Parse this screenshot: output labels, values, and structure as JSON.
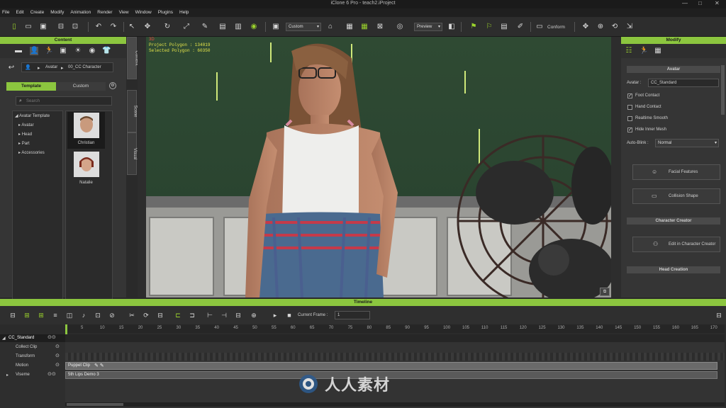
{
  "window": {
    "title": "iClone 6 Pro - teach2.iProject",
    "minimize": "—",
    "maximize": "□",
    "close": "✕"
  },
  "menu": [
    "File",
    "Edit",
    "Create",
    "Modify",
    "Animation",
    "Render",
    "View",
    "Window",
    "Plugins",
    "Help"
  ],
  "toolbar": {
    "view_select": "Custom",
    "quality_select": "Preview",
    "conform_label": "Conform"
  },
  "content_panel": {
    "title": "Content",
    "path": [
      "Avatar",
      "00_CC Character"
    ],
    "tabs": [
      "Template",
      "Custom"
    ],
    "search_placeholder": "Search",
    "tree": {
      "root": "Avatar Template",
      "children": [
        "Avatar",
        "Head",
        "Part",
        "Accessories"
      ]
    },
    "thumbnails": [
      {
        "name": "Christian"
      },
      {
        "name": "Natalie"
      }
    ],
    "down_btn": "⬇",
    "add_btn": "+"
  },
  "side_tabs": [
    "Content",
    "Scene",
    "Visual"
  ],
  "viewport": {
    "stats_line1": "Project Polygon : 134019",
    "stats_line2": "Selected Polygon : 60350",
    "corner_tag": "3D"
  },
  "modify_panel": {
    "title": "Modify",
    "section_avatar": "Avatar",
    "avatar_label": "Avatar :",
    "avatar_value": "CC_Standard",
    "checkboxes": [
      {
        "label": "Foot Contact",
        "checked": true
      },
      {
        "label": "Hand Contact",
        "checked": false
      },
      {
        "label": "Realtime Smooth",
        "checked": false
      },
      {
        "label": "Hide Inner Mesh",
        "checked": true
      }
    ],
    "autoblink_label": "Auto-Blink :",
    "autoblink_value": "Normal",
    "facial_btn": "Facial Features",
    "collision_btn": "Collision Shape",
    "section_cc": "Character Creator",
    "edit_cc_btn": "Edit in Character Creator",
    "section_head": "Head Creation"
  },
  "timeline": {
    "title": "Timeline",
    "current_frame_label": "Current Frame :",
    "current_frame_value": "1",
    "ruler": [
      "5",
      "10",
      "15",
      "20",
      "25",
      "30",
      "35",
      "40",
      "45",
      "50",
      "55",
      "60",
      "65",
      "70",
      "75",
      "80",
      "85",
      "90",
      "95",
      "100",
      "105",
      "110",
      "115",
      "120",
      "125",
      "130",
      "135",
      "140",
      "145",
      "150",
      "155",
      "160",
      "165",
      "170"
    ],
    "tracks": [
      {
        "label": "CC_Standard",
        "clip": ""
      },
      {
        "label": "Collect Clip",
        "clip": ""
      },
      {
        "label": "Transform",
        "clip": ""
      },
      {
        "label": "Motion",
        "clip": "Puppet Clip"
      },
      {
        "label": "Viseme",
        "clip": "5th Lips Demo 3"
      }
    ]
  },
  "watermark": "人人素材",
  "colors": {
    "accent": "#8cc63f",
    "panel": "#353535",
    "dark": "#1a1a1a"
  }
}
